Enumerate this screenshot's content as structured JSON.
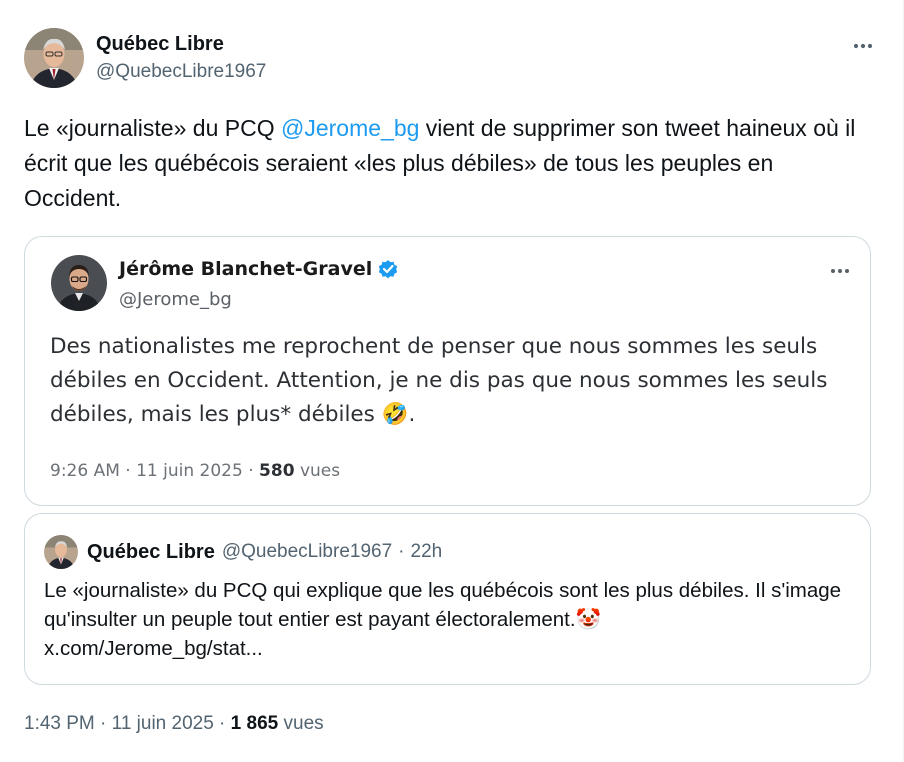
{
  "tweet": {
    "author_name": "Québec Libre",
    "author_handle": "@QuebecLibre1967",
    "more_icon": "more-horizontal-icon",
    "text_before_mention": "Le «journaliste» du PCQ ",
    "mention": "@Jerome_bg",
    "text_after_mention": " vient de supprimer son tweet haineux où il écrit que les québécois seraient «les plus débiles» de tous les peuples en Occident.",
    "time": "1:43 PM",
    "sep": " · ",
    "date": "11 juin 2025",
    "views_count": "1 865",
    "views_label": "vues"
  },
  "quoted_tweet": {
    "author_name": "Jérôme Blanchet-Gravel",
    "verified_icon": "verified-badge-icon",
    "author_handle": "@Jerome_bg",
    "text": "Des nationalistes me reprochent de penser que nous sommes les seuls débiles en Occident. Attention, je ne dis pas que nous sommes les seuls débiles, mais les plus* débiles ",
    "emoji": "🤣",
    "text_end": ".",
    "time": "9:26 AM",
    "sep": " · ",
    "date": "11 juin 2025",
    "views_count": "580",
    "views_label": "vues"
  },
  "nested_quote": {
    "author_name": "Québec Libre",
    "author_handle": "@QuebecLibre1967",
    "dot": "·",
    "relative_time": "22h",
    "text": "Le «journaliste» du PCQ qui explique que les québécois sont les plus débiles. Il s'image qu'insulter un peuple tout entier est payant électoralement.",
    "emoji": "🤡",
    "link": "x.com/Jerome_bg/stat..."
  },
  "colors": {
    "link": "#1d9bf0",
    "secondary_text": "#536471",
    "border": "#cfd9de",
    "verified": "#1d9bf0"
  }
}
